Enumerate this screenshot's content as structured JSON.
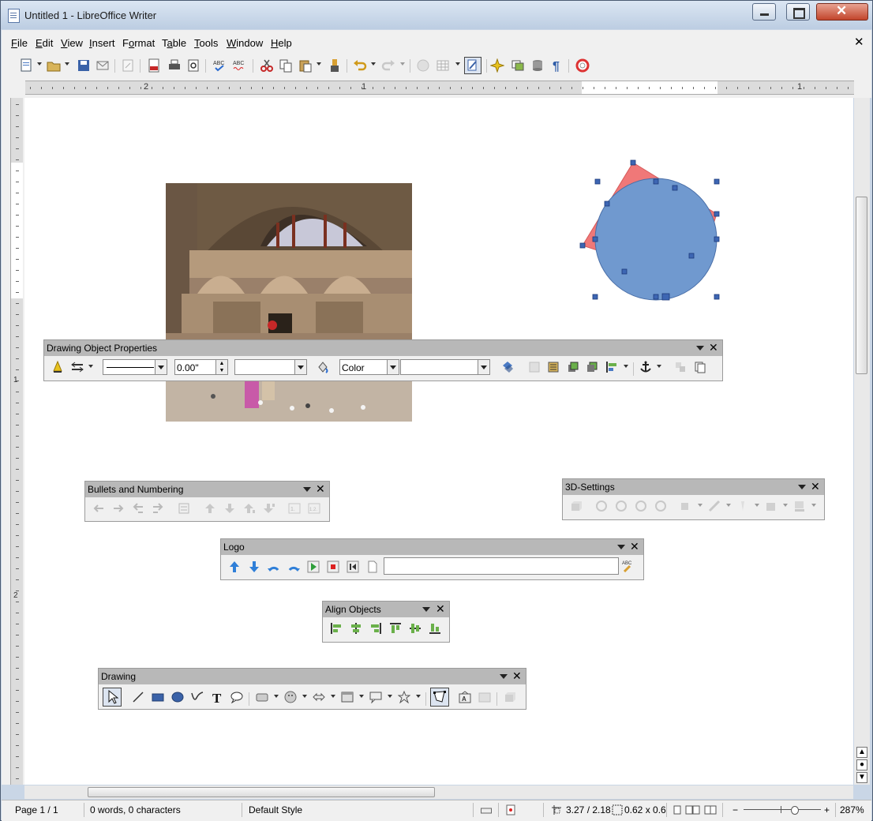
{
  "window": {
    "title": "Untitled 1 - LibreOffice Writer"
  },
  "menu": [
    "File",
    "Edit",
    "View",
    "Insert",
    "Format",
    "Table",
    "Tools",
    "Window",
    "Help"
  ],
  "menu_access": [
    "F",
    "E",
    "V",
    "I",
    "o",
    "a",
    "T",
    "W",
    "H"
  ],
  "document_close": "✕",
  "ruler": {
    "h_labels": [
      "2",
      "1",
      "1"
    ],
    "v_labels": [
      "1",
      "2"
    ]
  },
  "panels": {
    "drawing_object_properties": {
      "title": "Drawing Object Properties",
      "line_width": "0.00\"",
      "area_style": "Color",
      "close": "✕"
    },
    "bullets_and_numbering": {
      "title": "Bullets and Numbering",
      "close": "✕"
    },
    "three_d_settings": {
      "title": "3D-Settings",
      "close": "✕"
    },
    "logo": {
      "title": "Logo",
      "command_placeholder": "",
      "close": "✕"
    },
    "align_objects": {
      "title": "Align Objects",
      "close": "✕"
    },
    "drawing": {
      "title": "Drawing",
      "close": "✕"
    }
  },
  "statusbar": {
    "page": "Page 1 / 1",
    "words": "0 words, 0 characters",
    "style": "Default Style",
    "position": "3.27 / 2.18",
    "size": "0.62 x 0.6",
    "zoom": "287%"
  },
  "colors": {
    "shape_fill": "#7099cf",
    "triangle_fill": "#f07878",
    "handle": "#3d66b3"
  }
}
